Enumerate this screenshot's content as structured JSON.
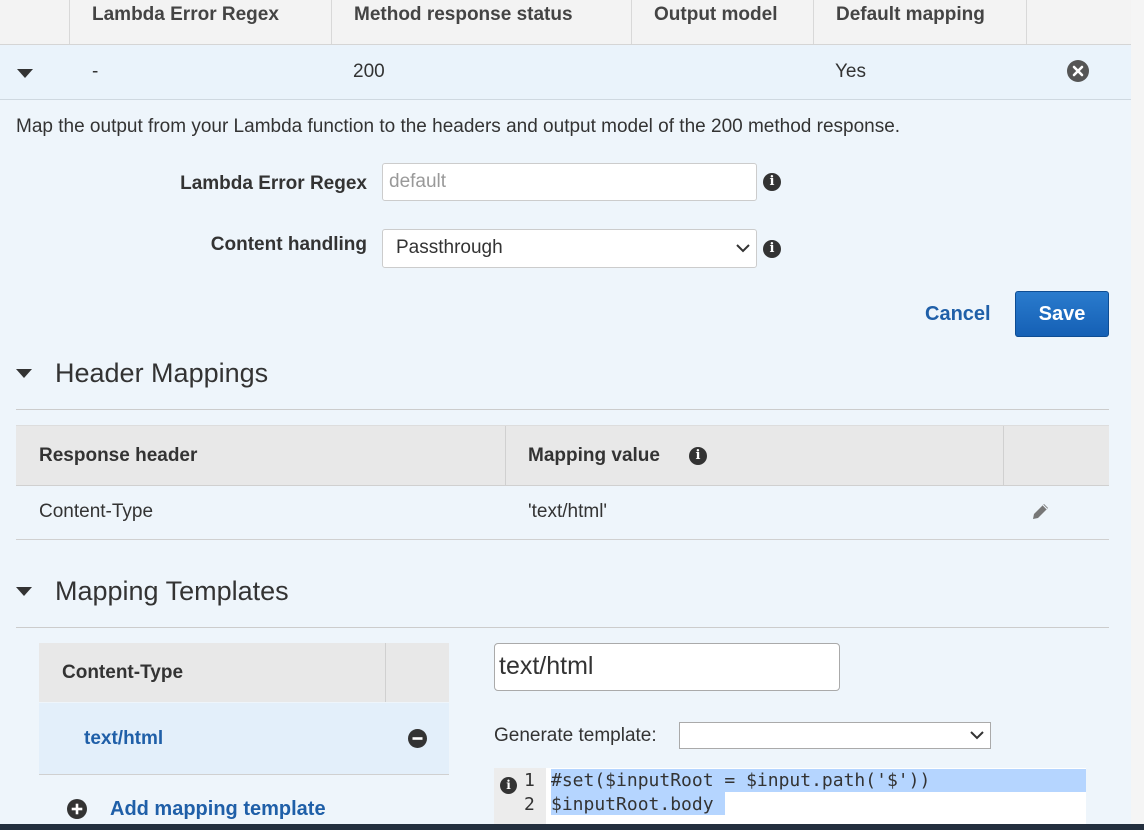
{
  "top_table": {
    "headers": [
      "Lambda Error Regex",
      "Method response status",
      "Output model",
      "Default mapping"
    ],
    "row": {
      "regex": "-",
      "status": "200",
      "output_model": "",
      "default_mapping": "Yes"
    }
  },
  "description": "Map the output from your Lambda function to the headers and output model of the 200 method response.",
  "form": {
    "regex_label": "Lambda Error Regex",
    "regex_placeholder": "default",
    "content_label": "Content handling",
    "content_value": "Passthrough"
  },
  "actions": {
    "cancel": "Cancel",
    "save": "Save"
  },
  "header_mappings": {
    "title": "Header Mappings",
    "columns": [
      "Response header",
      "Mapping value"
    ],
    "rows": [
      {
        "header": "Content-Type",
        "value": "'text/html'"
      }
    ]
  },
  "mapping_templates": {
    "title": "Mapping Templates",
    "list_header": "Content-Type",
    "items": [
      "text/html"
    ],
    "add_label": "Add mapping template",
    "content_type_value": "text/html",
    "generate_label": "Generate template:",
    "generate_value": "",
    "code_lines": [
      {
        "num": "1",
        "text": "#set($inputRoot = $input.path('$'))"
      },
      {
        "num": "2",
        "text": "$inputRoot.body"
      }
    ]
  },
  "icons": {
    "expand": "caret-down-icon",
    "remove": "close-circle-icon",
    "info": "info-icon",
    "edit": "pencil-icon",
    "delete_item": "minus-circle-icon",
    "add": "plus-circle-icon"
  },
  "colors": {
    "accent": "#1560b5",
    "link": "#1f5fa8",
    "panel_bg": "#eef5fb"
  }
}
